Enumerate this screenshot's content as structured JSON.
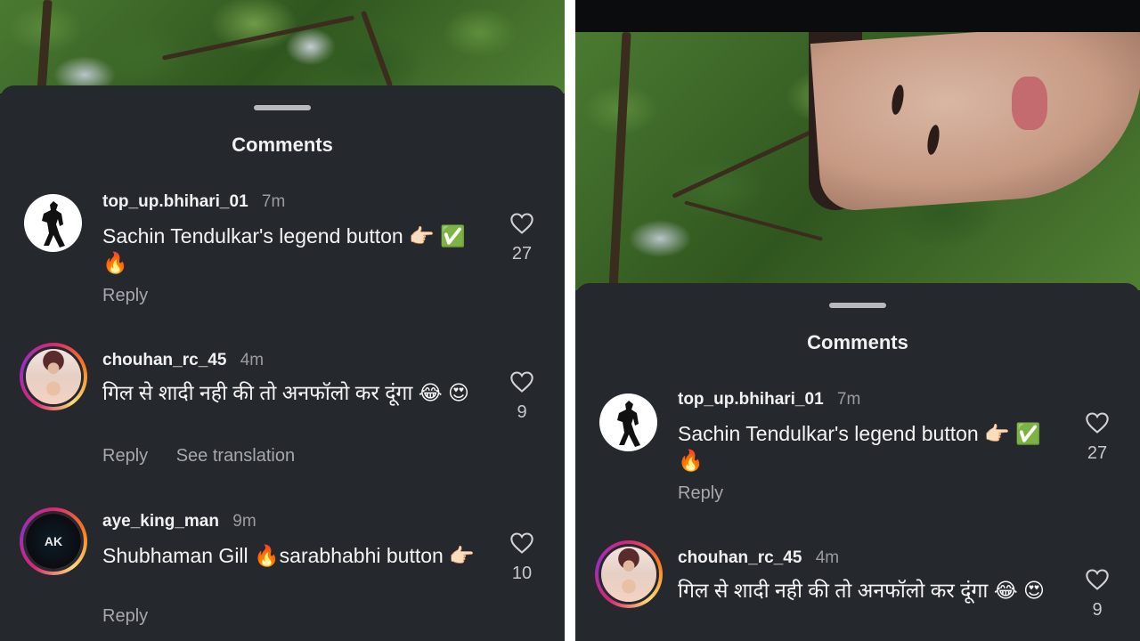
{
  "colors": {
    "sheet_bg": "#25282d",
    "text_primary": "#f1f1f1",
    "text_muted": "#9a9ca1",
    "story_ring": "#d62976"
  },
  "icons": {
    "like": "heart-outline-icon",
    "handle": "drag-handle"
  },
  "left": {
    "title": "Comments",
    "comments": [
      {
        "username": "top_up.bhihari_01",
        "time": "7m",
        "text": "Sachin Tendulkar's legend button 👉🏻 ✅🔥",
        "likes": "27",
        "reply": "Reply",
        "translate": ""
      },
      {
        "username": "chouhan_rc_45",
        "time": "4m",
        "text": "गिल से शादी नही की तो अनफॉलो कर दूंगा 😂 😍",
        "likes": "9",
        "reply": "Reply",
        "translate": "See translation"
      },
      {
        "username": "aye_king_man",
        "time": "9m",
        "text": "Shubhaman Gill 🔥sarabhabhi button 👉🏻",
        "likes": "10",
        "reply": "Reply",
        "translate": ""
      }
    ]
  },
  "right": {
    "title": "Comments",
    "comments": [
      {
        "username": "top_up.bhihari_01",
        "time": "7m",
        "text": "Sachin Tendulkar's legend button 👉🏻 ✅🔥",
        "likes": "27",
        "reply": "Reply"
      },
      {
        "username": "chouhan_rc_45",
        "time": "4m",
        "text": "गिल से शादी नही की तो अनफॉलो कर दूंगा 😂 😍",
        "likes": "9"
      }
    ]
  },
  "avatar_logo_text": "AK"
}
